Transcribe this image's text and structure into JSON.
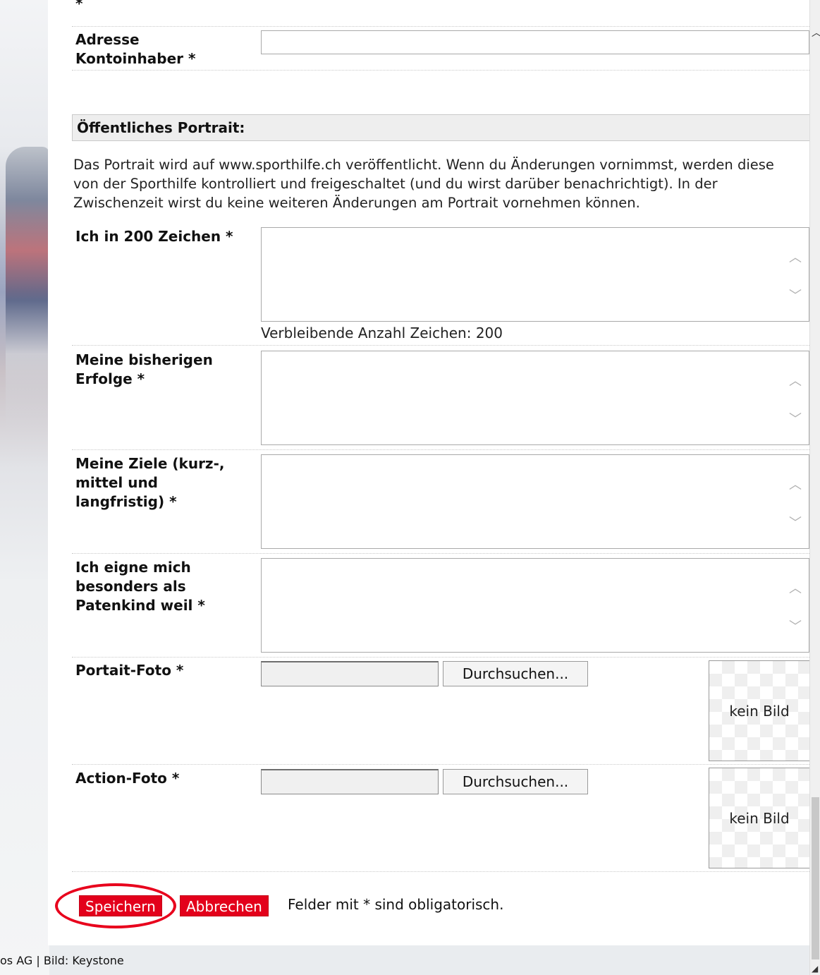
{
  "bank": {
    "top_label_tail": "*",
    "address_label_line1": "Adresse",
    "address_label_line2": "Kontoinhaber *",
    "address_value": ""
  },
  "portrait": {
    "section_title": "Öffentliches Portrait:",
    "description": "Das Portrait wird auf www.sporthilfe.ch veröffentlicht. Wenn du Änderungen vornimmst, werden diese von der Sporthilfe kontrolliert und freigeschaltet (und du wirst darüber benachrichtigt). In der Zwischenzeit wirst du keine weiteren Änderungen am Portrait vornehmen können.",
    "fields": [
      {
        "label_lines": [
          "Ich in 200 Zeichen *"
        ],
        "value": ""
      },
      {
        "label_lines": [
          "Meine bisherigen",
          "Erfolge *"
        ],
        "value": ""
      },
      {
        "label_lines": [
          "Meine Ziele (kurz-,",
          "mittel und",
          "langfristig) *"
        ],
        "value": ""
      },
      {
        "label_lines": [
          "Ich eigne mich",
          "besonders als",
          "Patenkind weil *"
        ],
        "value": ""
      }
    ],
    "counter_text": "Verbleibende Anzahl Zeichen: 200",
    "photos": [
      {
        "label": "Portait-Foto *",
        "browse_label": "Durchsuchen...",
        "preview_text": "kein Bild"
      },
      {
        "label": "Action-Foto *",
        "browse_label": "Durchsuchen...",
        "preview_text": "kein Bild"
      }
    ]
  },
  "actions": {
    "save_label": "Speichern",
    "cancel_label": "Abbrechen",
    "required_note": "Felder mit * sind obligatorisch."
  },
  "footer": {
    "text": "os AG | Bild: Keystone"
  },
  "colors": {
    "accent_red": "#e3001b",
    "highlight_circle": "#e8001c"
  }
}
